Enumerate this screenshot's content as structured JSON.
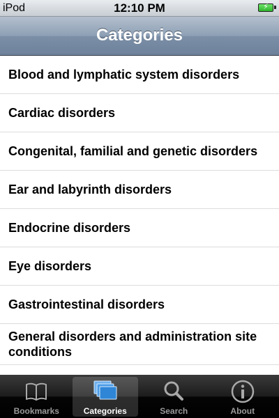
{
  "status_bar": {
    "carrier": "iPod",
    "time": "12:10 PM",
    "battery_icon": "battery-charging-icon"
  },
  "nav_bar": {
    "title": "Categories"
  },
  "categories": [
    "Blood and lymphatic system disorders",
    "Cardiac disorders",
    "Congenital, familial and genetic disorders",
    "Ear and labyrinth disorders",
    "Endocrine disorders",
    "Eye disorders",
    "Gastrointestinal disorders",
    "General disorders and administration site conditions"
  ],
  "tab_bar": {
    "tabs": [
      {
        "label": "Bookmarks",
        "icon": "book-icon",
        "selected": false
      },
      {
        "label": "Categories",
        "icon": "stacked-cards-icon",
        "selected": true
      },
      {
        "label": "Search",
        "icon": "magnifier-icon",
        "selected": false
      },
      {
        "label": "About",
        "icon": "info-icon",
        "selected": false
      }
    ]
  },
  "colors": {
    "nav_bar": "#8ea0b5",
    "tab_bar": "#000000",
    "selected_tab_icon": "#3f8fd9"
  }
}
